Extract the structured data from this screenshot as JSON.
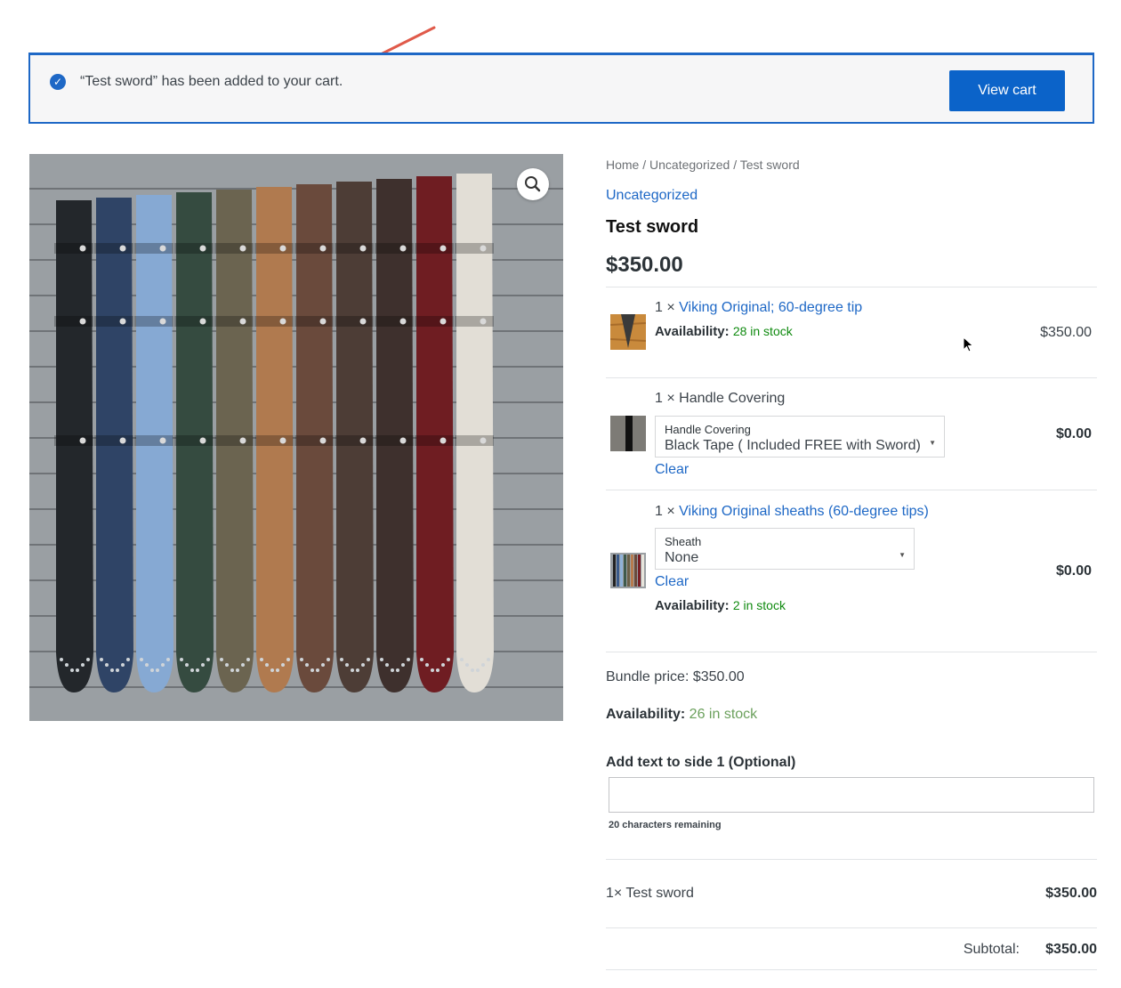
{
  "notice": {
    "message": "“Test sword” has been added to your cart.",
    "button_label": "View cart"
  },
  "breadcrumb": {
    "home": "Home",
    "sep": " / ",
    "category": "Uncategorized",
    "current": "Test sword"
  },
  "product": {
    "category": "Uncategorized",
    "title": "Test sword",
    "price": "$350.00"
  },
  "bundle_items": [
    {
      "qty": "1 ×",
      "name": "Viking Original; 60-degree tip",
      "availability_label": "Availability:",
      "availability_value": "28 in stock",
      "price": "$350.00"
    },
    {
      "qty": "1 ×",
      "name": "Handle Covering",
      "select_label": "Handle Covering",
      "select_value": "Black Tape ( Included FREE with Sword)",
      "clear_label": "Clear",
      "price": "$0.00"
    },
    {
      "qty": "1 ×",
      "name": "Viking Original sheaths (60-degree tips)",
      "select_label": "Sheath",
      "select_value": "None",
      "clear_label": "Clear",
      "availability_label": "Availability:",
      "availability_value": "2 in stock",
      "price": "$0.00"
    }
  ],
  "bundle_price": "Bundle price: $350.00",
  "stock": {
    "label": "Availability:",
    "value": "26 in stock"
  },
  "addon": {
    "label": "Add text to side 1 (Optional)",
    "value": "",
    "chars_remaining": "20 characters remaining"
  },
  "totals": {
    "line_name": "1× Test sword",
    "line_price": "$350.00",
    "subtotal_label": "Subtotal:",
    "subtotal_value": "$350.00"
  },
  "colors": {
    "accent": "#1e68c6",
    "button": "#0b63c9",
    "in_stock": "#0f8a0f",
    "annotation_arrow": "#e05a4a"
  },
  "icons": [
    "check-circle-icon",
    "magnify-icon",
    "dropdown-caret-icon",
    "mouse-pointer-icon"
  ]
}
